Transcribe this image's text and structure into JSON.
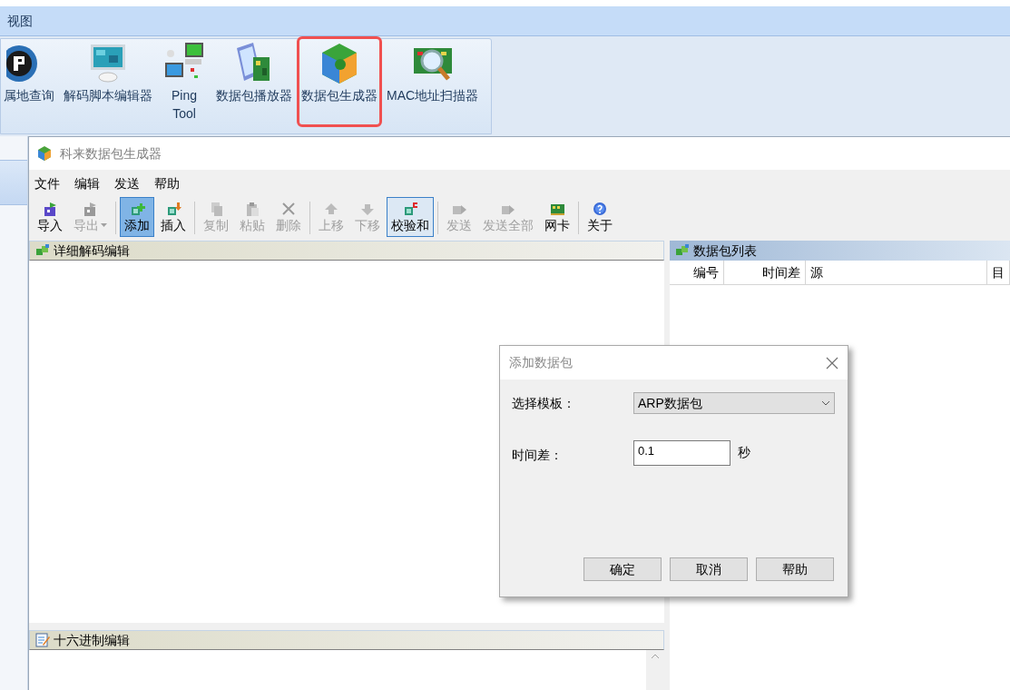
{
  "ribbon": {
    "tab": "视图",
    "tools": [
      {
        "label": "属地查询",
        "highlighted": false
      },
      {
        "label": "解码脚本编辑器",
        "highlighted": false
      },
      {
        "label": "Ping Tool",
        "highlighted": false
      },
      {
        "label": "数据包播放器",
        "highlighted": false
      },
      {
        "label": "数据包生成器",
        "highlighted": true
      },
      {
        "label": "MAC地址扫描器",
        "highlighted": false
      }
    ]
  },
  "window": {
    "title": "科来数据包生成器",
    "menu": [
      "文件",
      "编辑",
      "发送",
      "帮助"
    ],
    "toolbar": [
      [
        {
          "label": "导入",
          "disabled": false,
          "dropdown": false,
          "pressed": false,
          "hot": false
        },
        {
          "label": "导出",
          "disabled": true,
          "dropdown": true,
          "pressed": false,
          "hot": false
        }
      ],
      [
        {
          "label": "添加",
          "disabled": false,
          "dropdown": false,
          "pressed": true,
          "hot": false
        },
        {
          "label": "插入",
          "disabled": false,
          "dropdown": false,
          "pressed": false,
          "hot": false
        }
      ],
      [
        {
          "label": "复制",
          "disabled": true,
          "dropdown": false,
          "pressed": false,
          "hot": false
        },
        {
          "label": "粘贴",
          "disabled": true,
          "dropdown": false,
          "pressed": false,
          "hot": false
        },
        {
          "label": "删除",
          "disabled": true,
          "dropdown": false,
          "pressed": false,
          "hot": false
        }
      ],
      [
        {
          "label": "上移",
          "disabled": true,
          "dropdown": false,
          "pressed": false,
          "hot": false
        },
        {
          "label": "下移",
          "disabled": true,
          "dropdown": false,
          "pressed": false,
          "hot": false
        },
        {
          "label": "校验和",
          "disabled": false,
          "dropdown": false,
          "pressed": false,
          "hot": true
        }
      ],
      [
        {
          "label": "发送",
          "disabled": true,
          "dropdown": false,
          "pressed": false,
          "hot": false
        },
        {
          "label": "发送全部",
          "disabled": true,
          "dropdown": false,
          "pressed": false,
          "hot": false
        },
        {
          "label": "网卡",
          "disabled": false,
          "dropdown": false,
          "pressed": false,
          "hot": false
        }
      ],
      [
        {
          "label": "关于",
          "disabled": false,
          "dropdown": false,
          "pressed": false,
          "hot": false
        }
      ]
    ],
    "decode_pane": {
      "title": "详细解码编辑"
    },
    "hex_pane": {
      "title": "十六进制编辑"
    },
    "packet_list": {
      "title": "数据包列表",
      "columns": [
        "编号",
        "时间差",
        "源",
        "目"
      ]
    }
  },
  "dialog": {
    "title": "添加数据包",
    "template_label": "选择模板：",
    "template_value": "ARP数据包",
    "time_label": "时间差：",
    "time_value": "0.1",
    "time_unit": "秒",
    "buttons": [
      "确定",
      "取消",
      "帮助"
    ]
  }
}
